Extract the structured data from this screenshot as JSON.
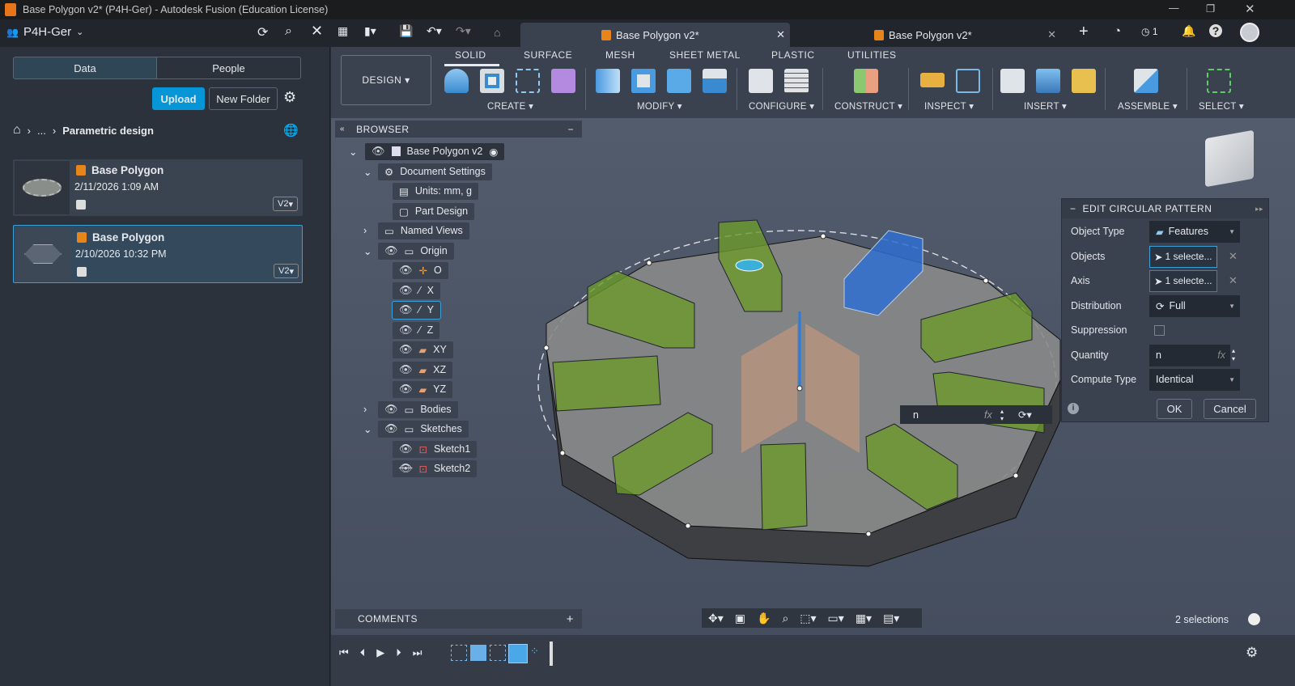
{
  "window": {
    "title": "Base Polygon v2* (P4H-Ger) - Autodesk Fusion (Education License)"
  },
  "appbar": {
    "team": "P4H-Ger",
    "tabs": [
      {
        "label": "Base Polygon v2*",
        "active": true
      },
      {
        "label": "Base Polygon v2*",
        "active": false
      }
    ],
    "notifications_count": "1"
  },
  "datapanel": {
    "tabs": [
      "Data",
      "People"
    ],
    "upload": "Upload",
    "new_folder": "New Folder",
    "breadcrumb": {
      "ellipsis": "...",
      "current": "Parametric design"
    },
    "files": [
      {
        "name": "Base Polygon",
        "date": "2/11/2026 1:09 AM",
        "version": "V2"
      },
      {
        "name": "Base Polygon",
        "date": "2/10/2026 10:32 PM",
        "version": "V2"
      }
    ]
  },
  "toolbar": {
    "workspace": "DESIGN",
    "tabs": [
      "SOLID",
      "SURFACE",
      "MESH",
      "SHEET METAL",
      "PLASTIC",
      "UTILITIES"
    ],
    "active_tab": "SOLID",
    "groups": [
      "CREATE",
      "MODIFY",
      "CONFIGURE",
      "CONSTRUCT",
      "INSPECT",
      "INSERT",
      "ASSEMBLE",
      "SELECT"
    ]
  },
  "browser": {
    "title": "BROWSER",
    "root": "Base Polygon v2",
    "items": [
      "Document Settings",
      "Units: mm, g",
      "Part Design",
      "Named Views",
      "Origin",
      "O",
      "X",
      "Y",
      "Z",
      "XY",
      "XZ",
      "YZ",
      "Bodies",
      "Sketches",
      "Sketch1",
      "Sketch2"
    ]
  },
  "comments": {
    "title": "COMMENTS"
  },
  "dialog": {
    "title": "EDIT CIRCULAR PATTERN",
    "rows": [
      {
        "label": "Object Type",
        "value": "Features"
      },
      {
        "label": "Objects",
        "value": "1 selecte..."
      },
      {
        "label": "Axis",
        "value": "1 selecte..."
      },
      {
        "label": "Distribution",
        "value": "Full"
      },
      {
        "label": "Suppression",
        "value": ""
      },
      {
        "label": "Quantity",
        "value": "n"
      },
      {
        "label": "Compute Type",
        "value": "Identical"
      }
    ],
    "fx": "fx",
    "ok": "OK",
    "cancel": "Cancel"
  },
  "inline_input": {
    "value": "n",
    "fx": "fx"
  },
  "status": {
    "selections": "2 selections"
  },
  "colors": {
    "accent": "#0696d7",
    "green_body": "#6b9a2a",
    "blue_body": "#2f6fd0"
  }
}
